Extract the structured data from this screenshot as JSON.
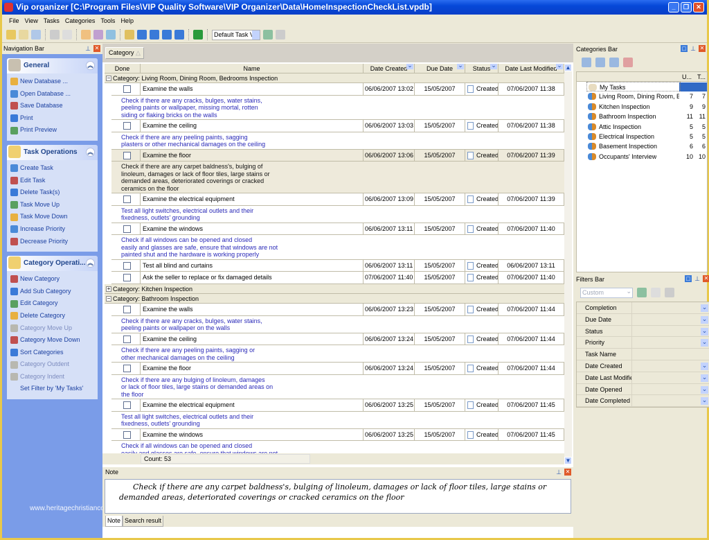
{
  "window": {
    "title": "Vip organizer [C:\\Program Files\\VIP Quality Software\\VIP Organizer\\Data\\HomeInspectionCheckList.vpdb]"
  },
  "menu": [
    "File",
    "View",
    "Tasks",
    "Categories",
    "Tools",
    "Help"
  ],
  "toolbar": {
    "view_select": "Default Task View"
  },
  "nav": {
    "title": "Navigation Bar",
    "panels": [
      {
        "title": "General",
        "items": [
          {
            "label": "New Database ..."
          },
          {
            "label": "Open Database ..."
          },
          {
            "label": "Save Database"
          },
          {
            "label": "Print"
          },
          {
            "label": "Print Preview"
          }
        ]
      },
      {
        "title": "Task Operations",
        "items": [
          {
            "label": "Create Task"
          },
          {
            "label": "Edit Task"
          },
          {
            "label": "Delete Task(s)"
          },
          {
            "label": "Task Move Up"
          },
          {
            "label": "Task Move Down"
          },
          {
            "label": "Increase Priority"
          },
          {
            "label": "Decrease Priority"
          }
        ]
      },
      {
        "title": "Category Operati...",
        "items": [
          {
            "label": "New Category"
          },
          {
            "label": "Add Sub Category"
          },
          {
            "label": "Edit Category"
          },
          {
            "label": "Delete Category"
          },
          {
            "label": "Category Move Up",
            "disabled": true
          },
          {
            "label": "Category Move Down"
          },
          {
            "label": "Sort Categories"
          },
          {
            "label": "Category Outdent",
            "disabled": true
          },
          {
            "label": "Category Indent",
            "disabled": true
          },
          {
            "label": "Set Filter by 'My Tasks'"
          }
        ]
      }
    ]
  },
  "watermark": "www.heritagechristiancollege.com",
  "grid": {
    "group_by": "Category",
    "columns": [
      "Done",
      "Name",
      "Date Created",
      "Due Date",
      "Status",
      "Date Last Modified"
    ],
    "groups": [
      {
        "label": "Category: Living Room, Dining Room, Bedrooms Inspection",
        "expanded": true,
        "tasks": [
          {
            "name": "Examine the walls",
            "created": "06/06/2007 13:02",
            "due": "15/05/2007",
            "status": "Created",
            "modified": "07/06/2007 11:38",
            "desc": "Check if there are any cracks, bulges, water stains,\npeeling paints or wallpaper, missing mortal, rotten\nsiding or flaking bricks on the walls"
          },
          {
            "name": "Examine the ceiling",
            "created": "06/06/2007 13:03",
            "due": "15/05/2007",
            "status": "Created",
            "modified": "07/06/2007 11:38",
            "desc": "Check if there are any peeling paints, sagging\nplasters or other mechanical damages on the ceiling"
          },
          {
            "name": "Examine the floor",
            "created": "06/06/2007 13:06",
            "due": "15/05/2007",
            "status": "Created",
            "modified": "07/06/2007 11:39",
            "selected": true,
            "desc": "Check if there are any carpet baldness's, bulging of\nlinoleum, damages or lack of floor tiles, large stains or\ndemanded areas, deteriorated coverings or cracked\nceramics on the floor"
          },
          {
            "name": "Examine the electrical equipment",
            "created": "06/06/2007 13:09",
            "due": "15/05/2007",
            "status": "Created",
            "modified": "07/06/2007 11:39",
            "desc": "Test all light switches, electrical outlets and their\nfixedness, outlets' grounding"
          },
          {
            "name": "Examine the windows",
            "created": "06/06/2007 13:11",
            "due": "15/05/2007",
            "status": "Created",
            "modified": "07/06/2007 11:40",
            "desc": "Check if all windows can be opened and closed\neasily and glasses are safe, ensure that windows are not\npainted shut and the hardware is working properly"
          },
          {
            "name": "Test all blind and curtains",
            "created": "06/06/2007 13:11",
            "due": "15/05/2007",
            "status": "Created",
            "modified": "06/06/2007 13:11",
            "desc": ""
          },
          {
            "name": "Ask the seller to replace or fix damaged details",
            "created": "07/06/2007 11:40",
            "due": "15/05/2007",
            "status": "Created",
            "modified": "07/06/2007 11:40",
            "desc": ""
          }
        ]
      },
      {
        "label": "Category: Kitchen Inspection",
        "expanded": false,
        "tasks": []
      },
      {
        "label": "Category: Bathroom Inspection",
        "expanded": true,
        "tasks": [
          {
            "name": "Examine the walls",
            "created": "06/06/2007 13:23",
            "due": "15/05/2007",
            "status": "Created",
            "modified": "07/06/2007 11:44",
            "desc": "Check if there are any cracks, bulges, water stains,\npeeling paints or wallpaper on the walls"
          },
          {
            "name": "Examine the ceiling",
            "created": "06/06/2007 13:24",
            "due": "15/05/2007",
            "status": "Created",
            "modified": "07/06/2007 11:44",
            "desc": "Check if there are any peeling paints, sagging or\nother mechanical damages on the ceiling"
          },
          {
            "name": "Examine the floor",
            "created": "06/06/2007 13:24",
            "due": "15/05/2007",
            "status": "Created",
            "modified": "07/06/2007 11:44",
            "desc": "Check if there are any bulging of linoleum, damages\nor lack of floor tiles, large stains or demanded areas on\nthe floor"
          },
          {
            "name": "Examine the electrical equipment",
            "created": "06/06/2007 13:25",
            "due": "15/05/2007",
            "status": "Created",
            "modified": "07/06/2007 11:45",
            "desc": "Test all light switches, electrical outlets and their\nfixedness, outlets' grounding"
          },
          {
            "name": "Examine the windows",
            "created": "06/06/2007 13:25",
            "due": "15/05/2007",
            "status": "Created",
            "modified": "07/06/2007 11:45",
            "desc": "Check if all windows can be opened and closed\neasily and glasses are safe, ensure that windows are not"
          }
        ]
      }
    ],
    "count": "Count: 53"
  },
  "note": {
    "title": "Note",
    "text": "Check if there are any carpet baldness's, bulging of linoleum, damages or lack of floor tiles, large stains or demanded areas, deteriorated coverings or cracked ceramics on the floor",
    "tabs": [
      "Note",
      "Search result"
    ]
  },
  "categories": {
    "title": "Categories Bar",
    "col_u": "U...",
    "col_t": "T...",
    "items": [
      {
        "label": "My Tasks",
        "u": "",
        "t": ""
      },
      {
        "label": "Living Room, Dining Room, Bedrooms Inspection",
        "u": "7",
        "t": "7"
      },
      {
        "label": "Kitchen Inspection",
        "u": "9",
        "t": "9"
      },
      {
        "label": "Bathroom Inspection",
        "u": "11",
        "t": "11"
      },
      {
        "label": "Attic Inspection",
        "u": "5",
        "t": "5"
      },
      {
        "label": "Electrical Inspection",
        "u": "5",
        "t": "5"
      },
      {
        "label": "Basement Inspection",
        "u": "6",
        "t": "6"
      },
      {
        "label": "Occupants' Interview",
        "u": "10",
        "t": "10"
      }
    ]
  },
  "filters": {
    "title": "Filters Bar",
    "preset": "Custom",
    "rows": [
      {
        "label": "Completion",
        "dd": true
      },
      {
        "label": "Due Date",
        "dd": true
      },
      {
        "label": "Status",
        "dd": true
      },
      {
        "label": "Priority",
        "dd": true
      },
      {
        "label": "Task Name",
        "dd": false
      },
      {
        "label": "Date Created",
        "dd": true
      },
      {
        "label": "Date Last Modified",
        "dd": true
      },
      {
        "label": "Date Opened",
        "dd": true
      },
      {
        "label": "Date Completed",
        "dd": true
      }
    ]
  }
}
